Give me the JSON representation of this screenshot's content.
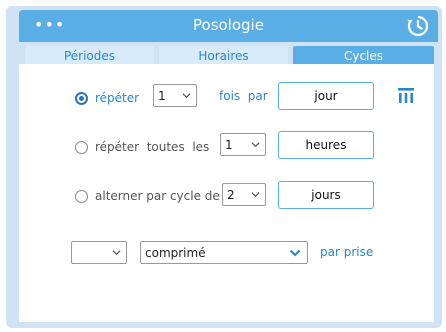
{
  "window": {
    "title": "Posologie",
    "menu_icon": "more-dots-icon",
    "history_icon": "history-icon"
  },
  "tabs": [
    {
      "label": "Périodes",
      "active": false
    },
    {
      "label": "Horaires",
      "active": false
    },
    {
      "label": "Cycles",
      "active": true
    }
  ],
  "options": [
    {
      "label_parts": [
        "répéter"
      ],
      "selected": true,
      "number": "1",
      "middle": "fois  par",
      "unit": "jour"
    },
    {
      "label_parts": [
        "répéter  toutes  les"
      ],
      "selected": false,
      "number": "1",
      "unit": "heures"
    },
    {
      "label_parts": [
        "alterner par cycle de"
      ],
      "selected": false,
      "number": "2",
      "unit": "jours"
    }
  ],
  "dose": {
    "quantity": "",
    "form": "comprimé",
    "suffix": "par prise"
  },
  "colors": {
    "accent": "#5aaee6",
    "link": "#2b86c9",
    "radio": "#2b74c4"
  }
}
